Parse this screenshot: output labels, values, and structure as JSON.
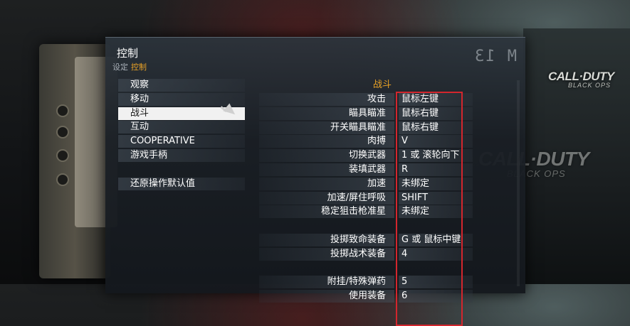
{
  "panel": {
    "title": "控制",
    "breadcrumb": {
      "parent": "设定",
      "current": "控制"
    },
    "counter": "M 13"
  },
  "background": {
    "logo_main": "CALL·DUTY",
    "logo_sub": "BLACK OPS"
  },
  "menu": {
    "items": [
      {
        "label": "观察"
      },
      {
        "label": "移动"
      },
      {
        "label": "战斗"
      },
      {
        "label": "互动"
      },
      {
        "label": "COOPERATIVE"
      },
      {
        "label": "游戏手柄"
      },
      {
        "label": "还原操作默认值"
      }
    ]
  },
  "bindings": {
    "section_title": "战斗",
    "rows": [
      {
        "action": "攻击",
        "key": "鼠标左键"
      },
      {
        "action": "瞄具瞄准",
        "key": "鼠标右键"
      },
      {
        "action": "开关瞄具瞄准",
        "key": "鼠标右键"
      },
      {
        "action": "肉搏",
        "key": "V"
      },
      {
        "action": "切换武器",
        "key": "1 或 滚轮向下"
      },
      {
        "action": "装填武器",
        "key": "R"
      },
      {
        "action": "加速",
        "key": "未绑定"
      },
      {
        "action": "加速/屏住呼吸",
        "key": "SHIFT"
      },
      {
        "action": "稳定狙击枪准星",
        "key": "未绑定"
      },
      {
        "action": "",
        "key": ""
      },
      {
        "action": "投掷致命装备",
        "key": "G 或 鼠标中键"
      },
      {
        "action": "投掷战术装备",
        "key": "4"
      },
      {
        "action": "",
        "key": ""
      },
      {
        "action": "附挂/特殊弹药",
        "key": "5"
      },
      {
        "action": "使用装备",
        "key": "6"
      }
    ]
  },
  "colors": {
    "accent": "#e8a126",
    "highlight_box": "#d3262d",
    "text": "#ffffff"
  }
}
